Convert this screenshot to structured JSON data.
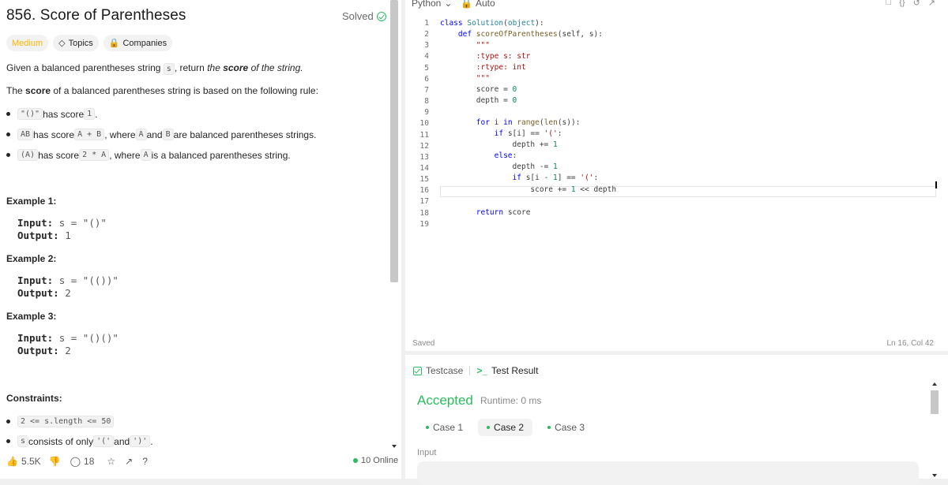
{
  "problem": {
    "title": "856. Score of Parentheses",
    "status": "Solved",
    "difficulty": "Medium",
    "topics": "Topics",
    "companies": "Companies",
    "desc1_pre": "Given a balanced parentheses string ",
    "desc1_code": "s",
    "desc1_post": ", return ",
    "desc1_italic_pre": "the ",
    "desc1_bold": "score",
    "desc1_italic_post": " of the string.",
    "desc2_pre": "The ",
    "desc2_bold": "score",
    "desc2_post": " of a balanced parentheses string is based on the following rule:",
    "rule1_code": "\"()\"",
    "rule1_text": " has score ",
    "rule1_val": "1",
    "rule1_end": ".",
    "rule2_a": "AB",
    "rule2_t1": " has score ",
    "rule2_b": "A + B",
    "rule2_t2": ", where ",
    "rule2_c": "A",
    "rule2_t3": " and ",
    "rule2_d": "B",
    "rule2_t4": " are balanced parentheses strings.",
    "rule3_a": "(A)",
    "rule3_t1": " has score ",
    "rule3_b": "2 * A",
    "rule3_t2": ", where ",
    "rule3_c": "A",
    "rule3_t3": " is a balanced parentheses string.",
    "examples": [
      {
        "title": "Example 1:",
        "input_label": "Input:",
        "input_val": "s = \"()\"",
        "output_label": "Output:",
        "output_val": "1"
      },
      {
        "title": "Example 2:",
        "input_label": "Input:",
        "input_val": "s = \"(())\"",
        "output_label": "Output:",
        "output_val": "2"
      },
      {
        "title": "Example 3:",
        "input_label": "Input:",
        "input_val": "s = \"()()\"",
        "output_label": "Output:",
        "output_val": "2"
      }
    ],
    "constraints_title": "Constraints:",
    "constraint1": "2 <= s.length <= 50",
    "constraint2_code_s": "s",
    "constraint2_text": " consists of only ",
    "constraint2_c1": "'('",
    "constraint2_and": " and ",
    "constraint2_c2": "')'",
    "constraint2_end": "."
  },
  "bottom": {
    "likes": "5.5K",
    "comments": "18",
    "online": "10 Online"
  },
  "editor": {
    "language": "Python",
    "mode": "Auto",
    "saved": "Saved",
    "cursor_pos": "Ln 16, Col 42",
    "line_numbers": [
      "1",
      "2",
      "3",
      "4",
      "5",
      "6",
      "7",
      "8",
      "9",
      "10",
      "11",
      "12",
      "13",
      "14",
      "15",
      "16",
      "17",
      "18",
      "19"
    ]
  },
  "result": {
    "tab_testcase": "Testcase",
    "tab_result": "Test Result",
    "verdict": "Accepted",
    "runtime": "Runtime: 0 ms",
    "cases": [
      "Case 1",
      "Case 2",
      "Case 3"
    ],
    "input_label": "Input"
  }
}
